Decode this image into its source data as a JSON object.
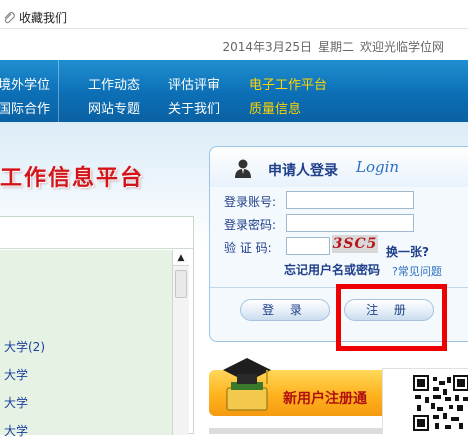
{
  "topbar": {
    "favorite_label": "收藏我们",
    "date": "2014年3月25日",
    "weekday": "星期二",
    "welcome": "欢迎光临学位网"
  },
  "nav": {
    "col1": [
      "境外学位",
      "国际合作"
    ],
    "col2": [
      "工作动态",
      "网站专题"
    ],
    "col3": [
      "评估评审",
      "关于我们"
    ],
    "col4": [
      "电子工作平台",
      "质量信息"
    ],
    "highlight_color": "#ffd400"
  },
  "banner": {
    "title": "工作信息平台",
    "title_color": "#d5141a"
  },
  "list": {
    "rows": [
      "大学(2)",
      "大学",
      "大学",
      "大学"
    ]
  },
  "login": {
    "title": "申请人登录",
    "title_en": "Login",
    "account_label": "登录账号:",
    "password_label": "登录密码:",
    "captcha_label": "验 证 码:",
    "account_value": "",
    "password_value": "",
    "captcha_value": "",
    "captcha_text": "3SC5",
    "refresh_label": "换一张?",
    "forgot_label": "忘记用户名或密码",
    "faq_label": "?常见问题",
    "login_button": "登 录",
    "register_button": "注 册"
  },
  "register_banner": {
    "text": "新用户注册通"
  },
  "colors": {
    "nav_blue": "#0c6fb5",
    "highlight_box": "#ee0000",
    "link_blue": "#1f3f8a"
  }
}
